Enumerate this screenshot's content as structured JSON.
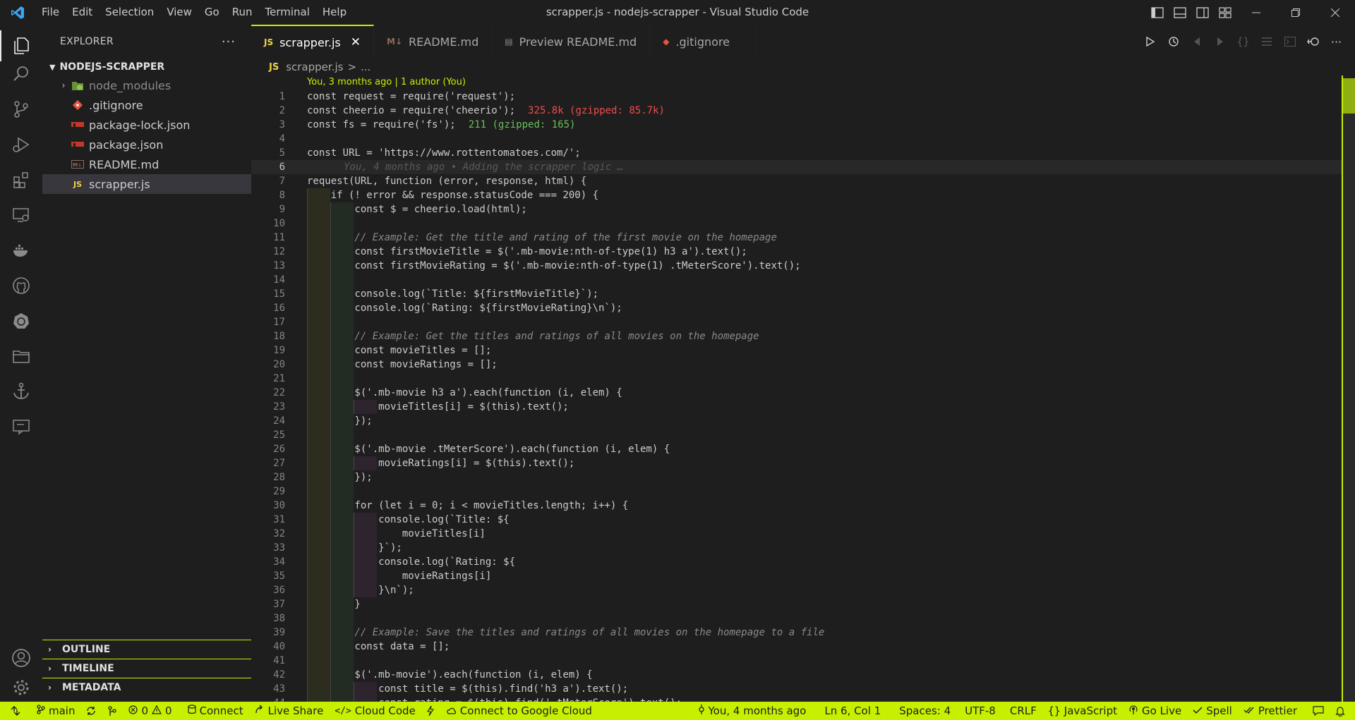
{
  "window": {
    "title": "scrapper.js - nodejs-scrapper - Visual Studio Code",
    "menu": [
      "File",
      "Edit",
      "Selection",
      "View",
      "Go",
      "Run",
      "Terminal",
      "Help"
    ]
  },
  "sidebar": {
    "header": "EXPLORER",
    "more": "···",
    "folder": "NODEJS-SCRAPPER",
    "items": [
      {
        "label": "node_modules",
        "icon": "node-folder-icon",
        "chevron": "›"
      },
      {
        "label": ".gitignore",
        "icon": "git-icon"
      },
      {
        "label": "package-lock.json",
        "icon": "npm-icon"
      },
      {
        "label": "package.json",
        "icon": "npm-icon"
      },
      {
        "label": "README.md",
        "icon": "markdown-icon"
      },
      {
        "label": "scrapper.js",
        "icon": "js-icon"
      }
    ],
    "sections": [
      "OUTLINE",
      "TIMELINE",
      "METADATA"
    ]
  },
  "tabs": [
    {
      "label": "scrapper.js",
      "icon": "JS",
      "active": true,
      "close": "✕"
    },
    {
      "label": "README.md",
      "icon": "M↓"
    },
    {
      "label": "Preview README.md",
      "icon": "▤"
    },
    {
      "label": ".gitignore",
      "icon": "◆"
    }
  ],
  "breadcrumb": {
    "file_icon": "JS",
    "file": "scrapper.js",
    "sep": ">",
    "rest": "..."
  },
  "editor": {
    "blame_top": "You, 3 months ago | 1 author (You)",
    "ghost_line": "You, 4 months ago • Adding the scrapper logic …",
    "current_line": 6,
    "hint_cheerio": "325.8k (gzipped: 85.7k)",
    "hint_fs": "211 (gzipped: 165)",
    "lines": [
      "const request = require('request');",
      "const cheerio = require('cheerio');",
      "const fs = require('fs');",
      "",
      "const URL = 'https://www.rottentomatoes.com/';",
      "",
      "request(URL, function (error, response, html) {",
      "    if (! error && response.statusCode === 200) {",
      "        const $ = cheerio.load(html);",
      "",
      "        // Example: Get the title and rating of the first movie on the homepage",
      "        const firstMovieTitle = $('.mb-movie:nth-of-type(1) h3 a').text();",
      "        const firstMovieRating = $('.mb-movie:nth-of-type(1) .tMeterScore').text();",
      "",
      "        console.log(`Title: ${firstMovieTitle}`);",
      "        console.log(`Rating: ${firstMovieRating}\\n`);",
      "",
      "        // Example: Get the titles and ratings of all movies on the homepage",
      "        const movieTitles = [];",
      "        const movieRatings = [];",
      "",
      "        $('.mb-movie h3 a').each(function (i, elem) {",
      "            movieTitles[i] = $(this).text();",
      "        });",
      "",
      "        $('.mb-movie .tMeterScore').each(function (i, elem) {",
      "            movieRatings[i] = $(this).text();",
      "        });",
      "",
      "        for (let i = 0; i < movieTitles.length; i++) {",
      "            console.log(`Title: ${",
      "                movieTitles[i]",
      "            }`);",
      "            console.log(`Rating: ${",
      "                movieRatings[i]",
      "            }\\n`);",
      "        }",
      "",
      "        // Example: Save the titles and ratings of all movies on the homepage to a file",
      "        const data = [];",
      "",
      "        $('.mb-movie').each(function (i, elem) {",
      "            const title = $(this).find('h3 a').text();",
      "            const rating = $(this).find('.tMeterScore').text();"
    ]
  },
  "statusbar": {
    "branch": "main",
    "errors": "0",
    "warnings": "0",
    "connect": "Connect",
    "live_share": "Live Share",
    "cloud_code": "Cloud Code",
    "google_cloud": "Connect to Google Cloud",
    "blame": "You, 4 months ago",
    "position": "Ln 6, Col 1",
    "spaces": "Spaces: 4",
    "encoding": "UTF-8",
    "eol": "CRLF",
    "language": "JavaScript",
    "go_live": "Go Live",
    "spell": "Spell",
    "prettier": "Prettier"
  },
  "colors": {
    "accent": "#c7f000",
    "background": "#1e1e1e",
    "sidebar_selected": "#37373d"
  }
}
